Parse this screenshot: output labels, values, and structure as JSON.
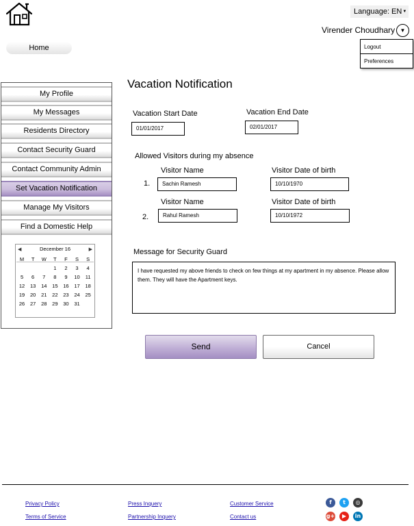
{
  "header": {
    "language_label": "Language: EN",
    "language_caret": "▼",
    "user_name": "Virender Choudhary",
    "user_menu": {
      "logout": "Logout",
      "preferences": "Preferences"
    },
    "home_tab": "Home",
    "home_icon": "house-icon"
  },
  "sidebar": {
    "items": [
      {
        "label": "My Profile"
      },
      {
        "label": "My Messages"
      },
      {
        "label": "Residents Directory"
      },
      {
        "label": "Contact Security Guard"
      },
      {
        "label": "Contact Community Admin"
      },
      {
        "label": "Set Vacation Notification",
        "active": true
      },
      {
        "label": "Manage My Visitors"
      },
      {
        "label": "Find a Domestic Help"
      }
    ],
    "calendar": {
      "month_label": "December 16",
      "day_headers": [
        "M",
        "T",
        "W",
        "T",
        "F",
        "S",
        "S"
      ],
      "weeks": [
        [
          "",
          "",
          "",
          "1",
          "2",
          "3",
          "4"
        ],
        [
          "5",
          "6",
          "7",
          "8",
          "9",
          "10",
          "11"
        ],
        [
          "12",
          "13",
          "14",
          "15",
          "16",
          "17",
          "18"
        ],
        [
          "19",
          "20",
          "21",
          "22",
          "23",
          "24",
          "25"
        ],
        [
          "26",
          "27",
          "28",
          "29",
          "30",
          "31",
          ""
        ]
      ]
    }
  },
  "main": {
    "title": "Vacation Notification",
    "start_date": {
      "label": "Vacation Start Date",
      "value": "01/01/2017"
    },
    "end_date": {
      "label": "Vacation End Date",
      "value": "02/01/2017"
    },
    "visitors_heading": "Allowed Visitors during my absence",
    "visitor_name_label": "Visitor Name",
    "visitor_dob_label": "Visitor Date of birth",
    "visitors": [
      {
        "number": "1.",
        "name": "Sachin Ramesh",
        "dob": "10/10/1970"
      },
      {
        "number": "2.",
        "name": "Rahul Ramesh",
        "dob": "10/10/1972"
      }
    ],
    "message_label": "Message for Security Guard",
    "message_text": "I have requested my above friends to check on few things at my apartment in my absence. Please allow them. They will have the Apartment keys.",
    "send_button": "Send",
    "cancel_button": "Cancel"
  },
  "footer": {
    "links": {
      "privacy": "Privacy Policy",
      "terms": "Terms of Service",
      "press": "Press Inquery",
      "partnership": "Partnership Inquery",
      "customer_service": "Customer Service",
      "contact": "Contact us"
    },
    "social": [
      {
        "icon": "facebook-icon",
        "glyph": "f",
        "color": "#3b5998"
      },
      {
        "icon": "twitter-icon",
        "glyph": "t",
        "color": "#1da1f2"
      },
      {
        "icon": "instagram-icon",
        "glyph": "◎",
        "color": "#3a3a3a"
      },
      {
        "icon": "google-plus-icon",
        "glyph": "g+",
        "color": "#dd4b39"
      },
      {
        "icon": "youtube-icon",
        "glyph": "▶",
        "color": "#e62117"
      },
      {
        "icon": "linkedin-icon",
        "glyph": "in",
        "color": "#0077b5"
      }
    ]
  }
}
